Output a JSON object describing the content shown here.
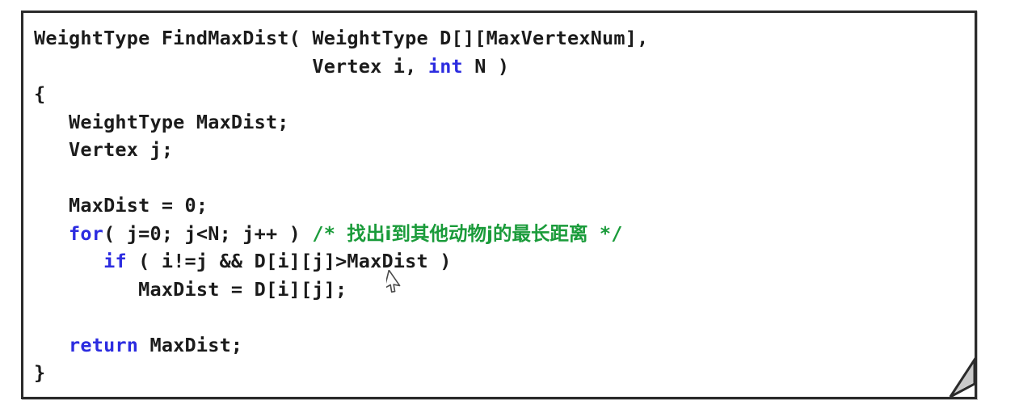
{
  "slide": {
    "frame_border_color": "#2b2b2b",
    "background_color": "#ffffff",
    "keyword_color": "#2c2ce0",
    "comment_color": "#1a9b3a",
    "text_color": "#1b1b1b"
  },
  "code": {
    "language": "c",
    "function_name": "FindMaxDist",
    "lines": [
      {
        "id": "line-1",
        "text": "WeightType FindMaxDist( WeightType D[][MaxVertexNum],"
      },
      {
        "id": "line-2",
        "indent": "                        ",
        "before": "Vertex i, ",
        "keyword": "int",
        "after": " N )"
      },
      {
        "id": "line-3",
        "text": "{"
      },
      {
        "id": "line-4",
        "text": "   WeightType MaxDist;"
      },
      {
        "id": "line-5",
        "text": "   Vertex j;"
      },
      {
        "id": "line-6",
        "text": ""
      },
      {
        "id": "line-7",
        "text": "   MaxDist = 0;"
      },
      {
        "id": "line-8",
        "indent": "   ",
        "keyword": "for",
        "after": "( j=0; j<N; j++ ) ",
        "comment_open": "/* ",
        "comment_cn": "找出i到其他动物j的最长距离",
        "comment_close": " */"
      },
      {
        "id": "line-9",
        "indent": "      ",
        "keyword": "if",
        "after": " ( i!=j && D[i][j]>MaxDist )"
      },
      {
        "id": "line-10",
        "text": "         MaxDist = D[i][j];"
      },
      {
        "id": "line-11",
        "text": ""
      },
      {
        "id": "line-12",
        "indent": "   ",
        "keyword": "return",
        "after": " MaxDist;"
      },
      {
        "id": "line-13",
        "text": "}"
      }
    ]
  },
  "decorations": {
    "folded_corner": "page-fold-bottom-right",
    "cursor": "mouse-arrow-pointer"
  }
}
